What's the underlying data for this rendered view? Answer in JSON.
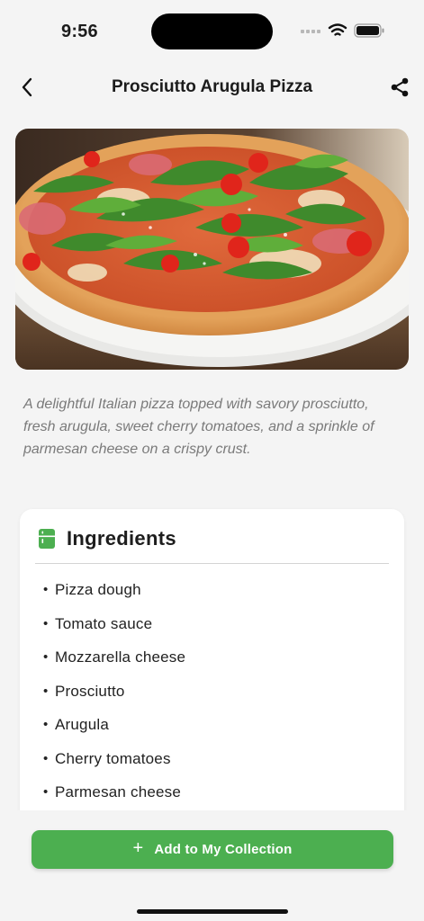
{
  "status_bar": {
    "time": "9:56",
    "icons": [
      "signal-icon",
      "wifi-icon",
      "battery-icon"
    ]
  },
  "nav": {
    "title": "Prosciutto Arugula Pizza",
    "back_icon": "chevron-left-icon",
    "share_icon": "share-icon"
  },
  "recipe": {
    "description": "A delightful Italian pizza topped with savory prosciutto, fresh arugula, sweet cherry tomatoes, and a sprinkle of parmesan cheese on a crispy crust."
  },
  "ingredients": {
    "title": "Ingredients",
    "icon": "kitchen-icon",
    "items": [
      "Pizza dough",
      "Tomato sauce",
      "Mozzarella cheese",
      "Prosciutto",
      "Arugula",
      "Cherry tomatoes",
      "Parmesan cheese"
    ]
  },
  "actions": {
    "add_label": "Add to My Collection"
  },
  "colors": {
    "accent": "#4caf50",
    "background": "#f4f4f4",
    "description_text": "#7a7a7a"
  }
}
